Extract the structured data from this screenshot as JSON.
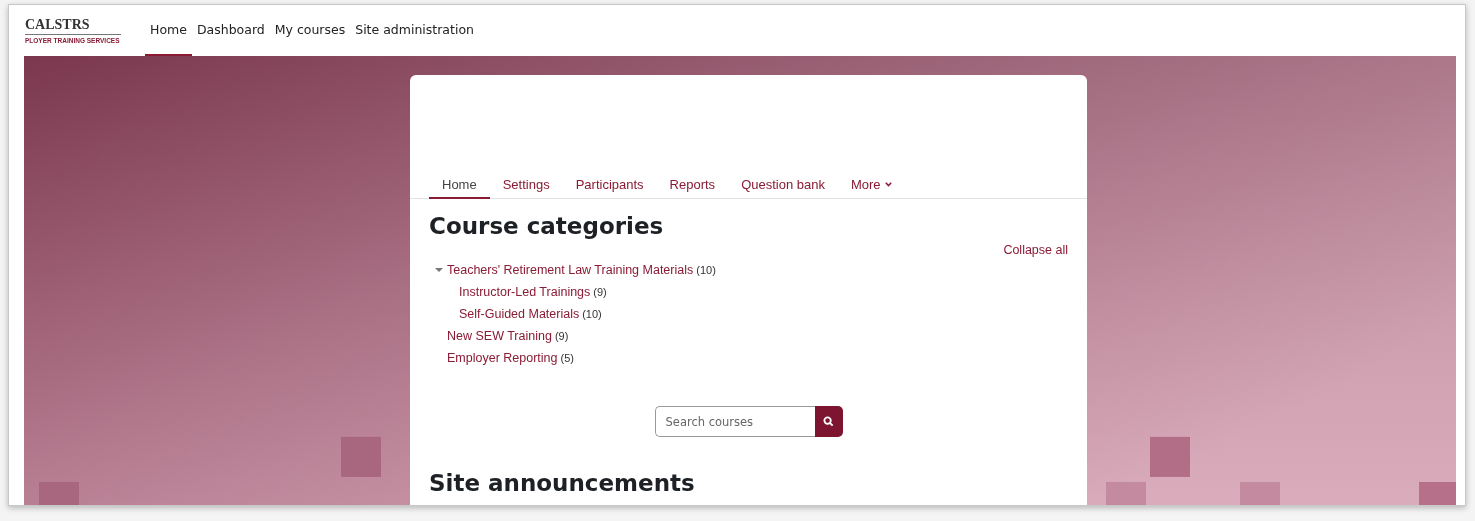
{
  "logo": {
    "title": "CALSTRS",
    "subtitle": "PLOYER TRAINING SERVICES"
  },
  "primary_nav": [
    {
      "label": "Home",
      "selected": true
    },
    {
      "label": "Dashboard",
      "selected": false
    },
    {
      "label": "My courses",
      "selected": false
    },
    {
      "label": "Site administration",
      "selected": false
    }
  ],
  "secondary_nav": [
    {
      "label": "Home",
      "selected": true,
      "kind": "link"
    },
    {
      "label": "Settings",
      "selected": false,
      "kind": "link"
    },
    {
      "label": "Participants",
      "selected": false,
      "kind": "link"
    },
    {
      "label": "Reports",
      "selected": false,
      "kind": "link"
    },
    {
      "label": "Question bank",
      "selected": false,
      "kind": "link"
    },
    {
      "label": "More",
      "selected": false,
      "kind": "dropdown"
    }
  ],
  "page_title": "Course categories",
  "collapse_link": "Collapse all",
  "categories": [
    {
      "name": "Teachers' Retirement Law Training Materials",
      "count": "(10)",
      "expanded": true,
      "children": [
        {
          "name": "Instructor-Led Trainings",
          "count": "(9)"
        },
        {
          "name": "Self-Guided Materials",
          "count": "(10)"
        }
      ]
    },
    {
      "name": "New SEW Training",
      "count": "(9)"
    },
    {
      "name": "Employer Reporting",
      "count": "(5)"
    }
  ],
  "search": {
    "placeholder": "Search courses"
  },
  "section_title": "Site announcements"
}
